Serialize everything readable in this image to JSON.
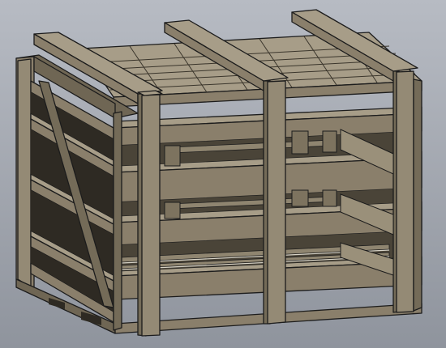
{
  "scene": {
    "subject": "wooden-crate",
    "viewport_background": "#9fa4ad",
    "colors": {
      "wood_top": "#a79d88",
      "wood_front": "#8a7f6b",
      "wood_side": "#6f6654",
      "wood_shadow": "#2e2a23",
      "edge": "#1c1c1c"
    }
  }
}
